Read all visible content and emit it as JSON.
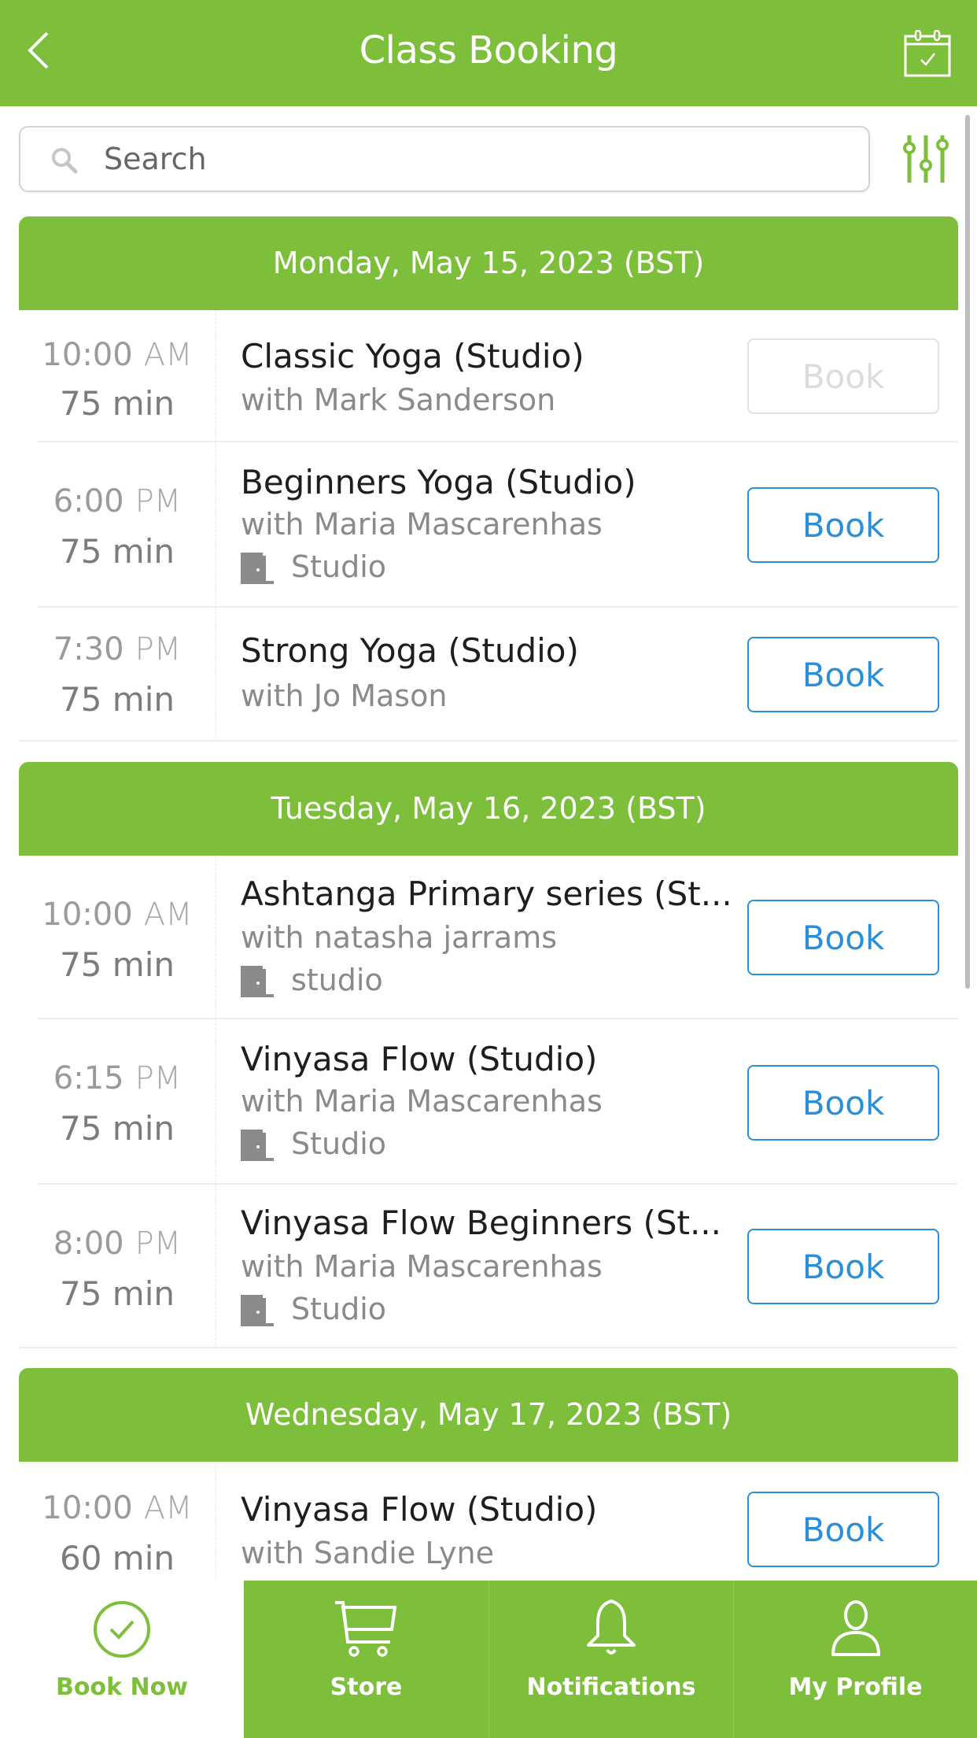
{
  "header": {
    "title": "Class Booking",
    "back_icon": "chevron-left-icon",
    "calendar_icon": "calendar-check-icon"
  },
  "search": {
    "placeholder": "Search",
    "value": "",
    "filter_icon": "sliders-icon"
  },
  "colors": {
    "brand": "#7dbf3b",
    "link": "#2a8fd6",
    "disabled": "#dcdcdc"
  },
  "days": [
    {
      "label": "Monday, May 15, 2023 (BST)",
      "classes": [
        {
          "time": "10:00",
          "ampm": "AM",
          "duration": "75 min",
          "name": "Classic Yoga (Studio)",
          "instructor": "with Mark Sanderson",
          "location": "",
          "book_label": "Book",
          "book_enabled": false
        },
        {
          "time": "6:00",
          "ampm": "PM",
          "duration": "75 min",
          "name": "Beginners Yoga (Studio)",
          "instructor": "with Maria Mascarenhas",
          "location": "Studio",
          "book_label": "Book",
          "book_enabled": true
        },
        {
          "time": "7:30",
          "ampm": "PM",
          "duration": "75 min",
          "name": "Strong Yoga (Studio)",
          "instructor": "with Jo Mason",
          "location": "",
          "book_label": "Book",
          "book_enabled": true
        }
      ]
    },
    {
      "label": "Tuesday, May 16, 2023 (BST)",
      "classes": [
        {
          "time": "10:00",
          "ampm": "AM",
          "duration": "75 min",
          "name": "Ashtanga Primary series (St...",
          "instructor": "with natasha jarrams",
          "location": "studio",
          "book_label": "Book",
          "book_enabled": true
        },
        {
          "time": "6:15",
          "ampm": "PM",
          "duration": "75 min",
          "name": "Vinyasa Flow (Studio)",
          "instructor": "with Maria Mascarenhas",
          "location": "Studio",
          "book_label": "Book",
          "book_enabled": true
        },
        {
          "time": "8:00",
          "ampm": "PM",
          "duration": "75 min",
          "name": "Vinyasa Flow Beginners (St...",
          "instructor": "with Maria Mascarenhas",
          "location": "Studio",
          "book_label": "Book",
          "book_enabled": true
        }
      ]
    },
    {
      "label": "Wednesday, May 17, 2023 (BST)",
      "classes": [
        {
          "time": "10:00",
          "ampm": "AM",
          "duration": "60 min",
          "name": "Vinyasa Flow (Studio)",
          "instructor": "with Sandie Lyne",
          "location": "",
          "book_label": "Book",
          "book_enabled": true
        }
      ]
    }
  ],
  "tabs": [
    {
      "label": "Book Now",
      "icon": "check-circle-icon",
      "active": true
    },
    {
      "label": "Store",
      "icon": "cart-icon",
      "active": false
    },
    {
      "label": "Notifications",
      "icon": "bell-icon",
      "active": false
    },
    {
      "label": "My Profile",
      "icon": "user-icon",
      "active": false
    }
  ]
}
